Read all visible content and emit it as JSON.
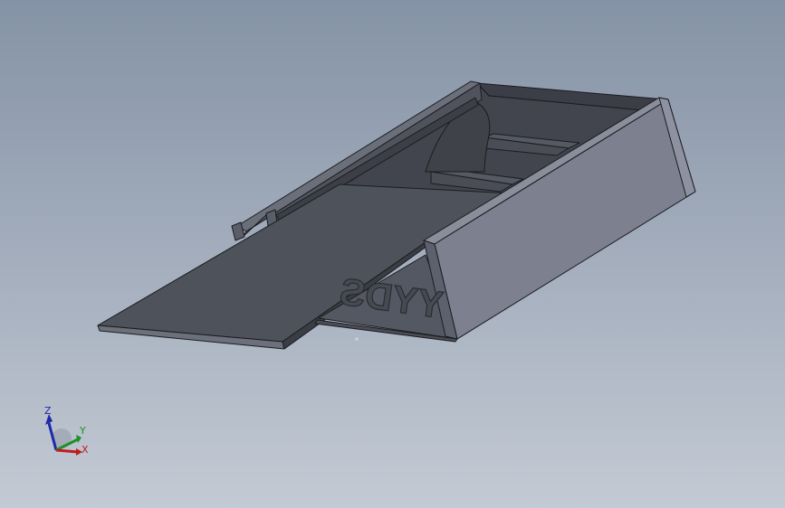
{
  "model": {
    "engraved_text": "YYDS"
  },
  "triad": {
    "labels": {
      "z": "Z",
      "y": "Y",
      "x": "X"
    },
    "colors": {
      "z": "#1a2aa8",
      "y": "#1f8f2a",
      "x": "#c01c1c"
    }
  },
  "colors": {
    "background_top": "#8593a6",
    "background_bottom": "#c3cad4",
    "model_dark": "#3f434c",
    "model_mid": "#5f6470",
    "model_light": "#7d8190",
    "edge": "#1b1c20"
  }
}
